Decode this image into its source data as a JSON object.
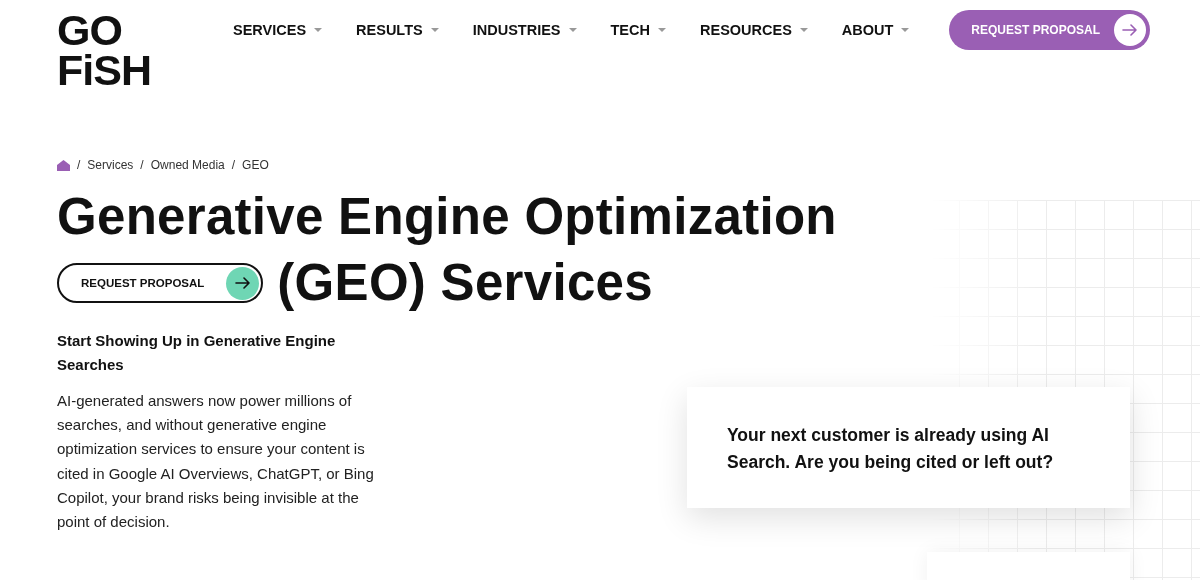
{
  "logo": {
    "lines": [
      "GO",
      "FiSH"
    ]
  },
  "nav": [
    {
      "label": "SERVICES",
      "has_menu": true
    },
    {
      "label": "RESULTS",
      "has_menu": true
    },
    {
      "label": "INDUSTRIES",
      "has_menu": true
    },
    {
      "label": "TECH",
      "has_menu": true
    },
    {
      "label": "RESOURCES",
      "has_menu": true
    },
    {
      "label": "ABOUT",
      "has_menu": true
    }
  ],
  "header_button": {
    "label": "REQUEST PROPOSAL"
  },
  "breadcrumb": [
    {
      "separator": "/",
      "label": "Services"
    },
    {
      "separator": "/",
      "label": "Owned Media"
    },
    {
      "separator": "/",
      "label": "GEO"
    }
  ],
  "title": {
    "line_1": "Generative Engine Optimization",
    "line_2": "(GEO) Services"
  },
  "hero_button": {
    "label": "REQUEST PROPOSAL"
  },
  "subtitle": "Start Showing Up in Generative Engine Searches",
  "body": "AI-generated answers now power millions of searches, and without generative engine optimization services to ensure your content is cited in Google AI Overviews, ChatGPT, or Bing Copilot, your brand risks being invisible at the point of decision.",
  "callout": "Your next customer is already using AI Search. Are you being cited or left out?"
}
